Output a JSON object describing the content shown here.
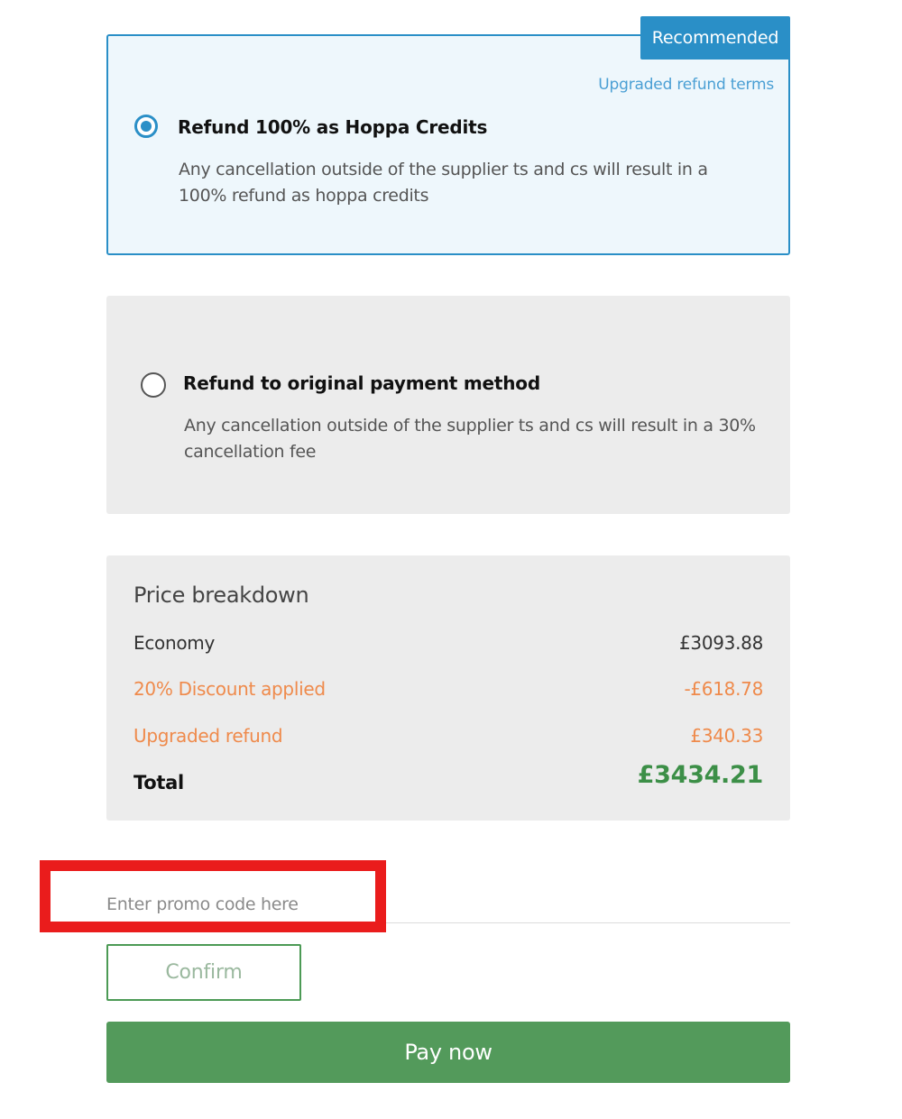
{
  "refund_options": {
    "hoppa_credits": {
      "badge": "Recommended",
      "link": "Upgraded refund terms",
      "title": "Refund 100% as Hoppa Credits",
      "description": "Any cancellation outside of the supplier ts and cs will result in a 100% refund as hoppa credits",
      "selected": true
    },
    "original_payment": {
      "title": "Refund to original payment method",
      "description": "Any cancellation outside of the supplier ts and cs will result in a 30% cancellation fee",
      "selected": false
    }
  },
  "price_breakdown": {
    "title": "Price breakdown",
    "rows": [
      {
        "label": "Economy",
        "amount": "£3093.88"
      },
      {
        "label": "20% Discount applied",
        "amount": "-£618.78"
      },
      {
        "label": "Upgraded refund",
        "amount": "£340.33"
      }
    ],
    "total_label": "Total",
    "total_amount": "£3434.21"
  },
  "promo": {
    "value": "",
    "placeholder": "Enter promo code here",
    "confirm_label": "Confirm"
  },
  "pay_label": "Pay now",
  "colors": {
    "accent_blue": "#2a8fc7",
    "selected_bg": "#eef7fc",
    "panel_bg": "#ececec",
    "orange": "#ef8a4b",
    "green": "#539a5b",
    "total_green": "#3c8f47",
    "highlight_red": "#ea1c1c"
  }
}
